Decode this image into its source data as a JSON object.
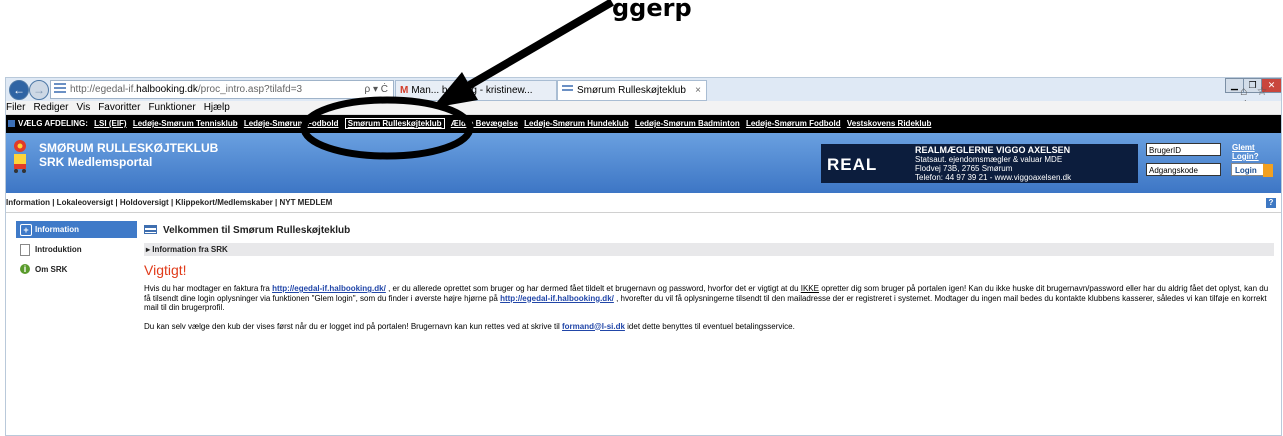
{
  "caption": {
    "text": "ggerp"
  },
  "browser": {
    "url_prefix": "http://egedal-if.",
    "url_host": "halbooking.dk",
    "url_path": "/proc_intro.asp?tilafd=3",
    "address_tools": "ρ ▾ Ċ",
    "tabs": [
      {
        "label": "Man... betaling - kristinew...",
        "icon": "gmail-m-icon"
      },
      {
        "label": "Smørum Rulleskøjteklub",
        "icon": "page-icon",
        "active": true
      }
    ],
    "menu": [
      "Filer",
      "Rediger",
      "Vis",
      "Favoritter",
      "Funktioner",
      "Hjælp"
    ],
    "corner_icons": "⌂ ☆ ⚙"
  },
  "dept_bar": {
    "lead": "VÆLG AFDELING:",
    "items": [
      "LSI (EIF)",
      "Ledøje-Smørum Tennisklub",
      "Ledøje-Smørum Fodbold",
      "Smørum Rulleskøjteklub",
      "Ældre Bevægelse",
      "Ledøje-Smørum Hundeklub",
      "Ledøje-Smørum Badminton",
      "Ledøje-Smørum Fodbold",
      "Vestskovens Rideklub"
    ],
    "selected_index": 3
  },
  "header": {
    "title_line1": "SMØRUM RULLESKØJTEKLUB",
    "title_line2": "SRK Medlemsportal",
    "ad_logo": "REAL",
    "ad_line1": "REALMÆGLERNE VIGGO AXELSEN",
    "ad_line2": "Statsaut. ejendomsmægler & valuar MDE",
    "ad_line3": "Flodvej 73B, 2765 Smørum",
    "ad_line4": "Telefon: 44 97 39 21 - www.viggoaxelsen.dk",
    "user_placeholder": "BrugerID",
    "pass_placeholder": "Adgangskode",
    "forgot_label": "Glemt Login?",
    "login_label": "Login"
  },
  "subnav": {
    "text": "Information | Lokaleoversigt | Holdoversigt | Klippekort/Medlemskaber | NYT MEDLEM",
    "help": "?"
  },
  "sidebar": {
    "items": [
      {
        "label": "Information",
        "icon": "plus-icon",
        "active": true
      },
      {
        "label": "Introduktion",
        "icon": "document-icon"
      },
      {
        "label": "Om SRK",
        "icon": "info-icon"
      }
    ]
  },
  "main": {
    "title": "Velkommen til Smørum Rulleskøjteklub",
    "crumb": "▸ Information fra SRK",
    "heading": "Vigtigt!",
    "p1_a": "Hvis du har modtager en faktura fra ",
    "link1": "http://egedal-if.halbooking.dk/",
    "p1_b": " , er du allerede oprettet som bruger og har dermed fået tildelt et brugernavn og password, hvorfor det er vigtigt at du ",
    "p1_ikke": "IKKE",
    "p1_c": " opretter dig som bruger på portalen igen! Kan du ikke huske dit brugernavn/password eller har du aldrig fået det oplyst, kan du få tilsendt dine login oplysninger via funktionen \"Glem login\", som du finder i øverste højre hjørne på ",
    "link2": "http://egedal-if.halbooking.dk/",
    "p1_d": " , hvorefter du vil få oplysningerne tilsendt til den mailadresse der er registreret i systemet. Modtager du ingen mail bedes du kontakte klubbens kasserer, således vi kan tilføje en korrekt mail til din brugerprofil.",
    "p2_a": "Du kan selv vælge den kub der vises først når du er logget ind på portalen! Brugernavn kan kun rettes ved at skrive til ",
    "link3": "formand@l-si.dk",
    "p2_b": " idet dette benyttes til eventuel betalingsservice."
  }
}
